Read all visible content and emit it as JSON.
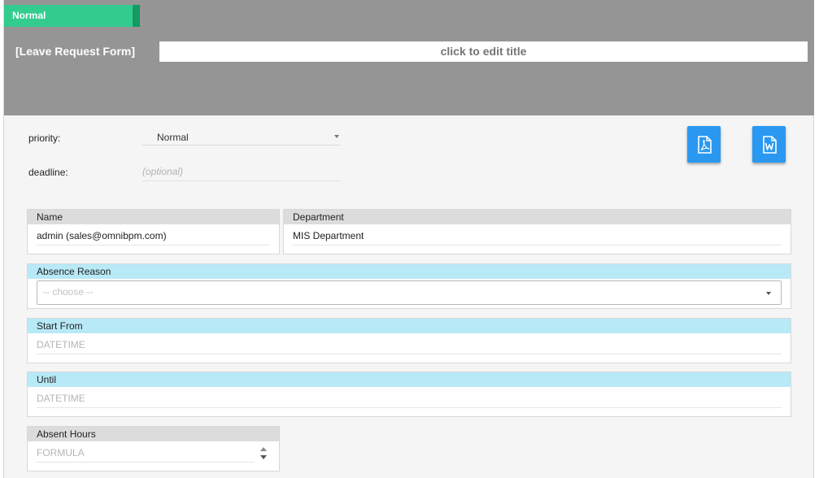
{
  "header": {
    "status_badge": "Normal",
    "form_name": "[Leave Request Form]",
    "title_placeholder": "click to edit title"
  },
  "meta": {
    "priority_label": "priority:",
    "priority_value": "Normal",
    "deadline_label": "deadline:",
    "deadline_placeholder": "(optional)"
  },
  "export": {
    "pdf_icon": "pdf-file-icon",
    "word_icon": "word-file-icon",
    "accent_color": "#2a98f0"
  },
  "fields": {
    "name": {
      "label": "Name",
      "value": "admin (sales@omnibpm.com)"
    },
    "department": {
      "label": "Department",
      "value": "MIS Department"
    },
    "absence_reason": {
      "label": "Absence Reason",
      "placeholder": "-- choose --"
    },
    "start_from": {
      "label": "Start From",
      "placeholder": "DATETIME"
    },
    "until": {
      "label": "Until",
      "placeholder": "DATETIME"
    },
    "absent_hours": {
      "label": "Absent Hours",
      "placeholder": "FORMULA"
    }
  },
  "colors": {
    "badge_green": "#33cc8f",
    "header_gray": "#959595",
    "required_field_header": "#b8e9f7",
    "readonly_field_header": "#dcdcdc"
  }
}
